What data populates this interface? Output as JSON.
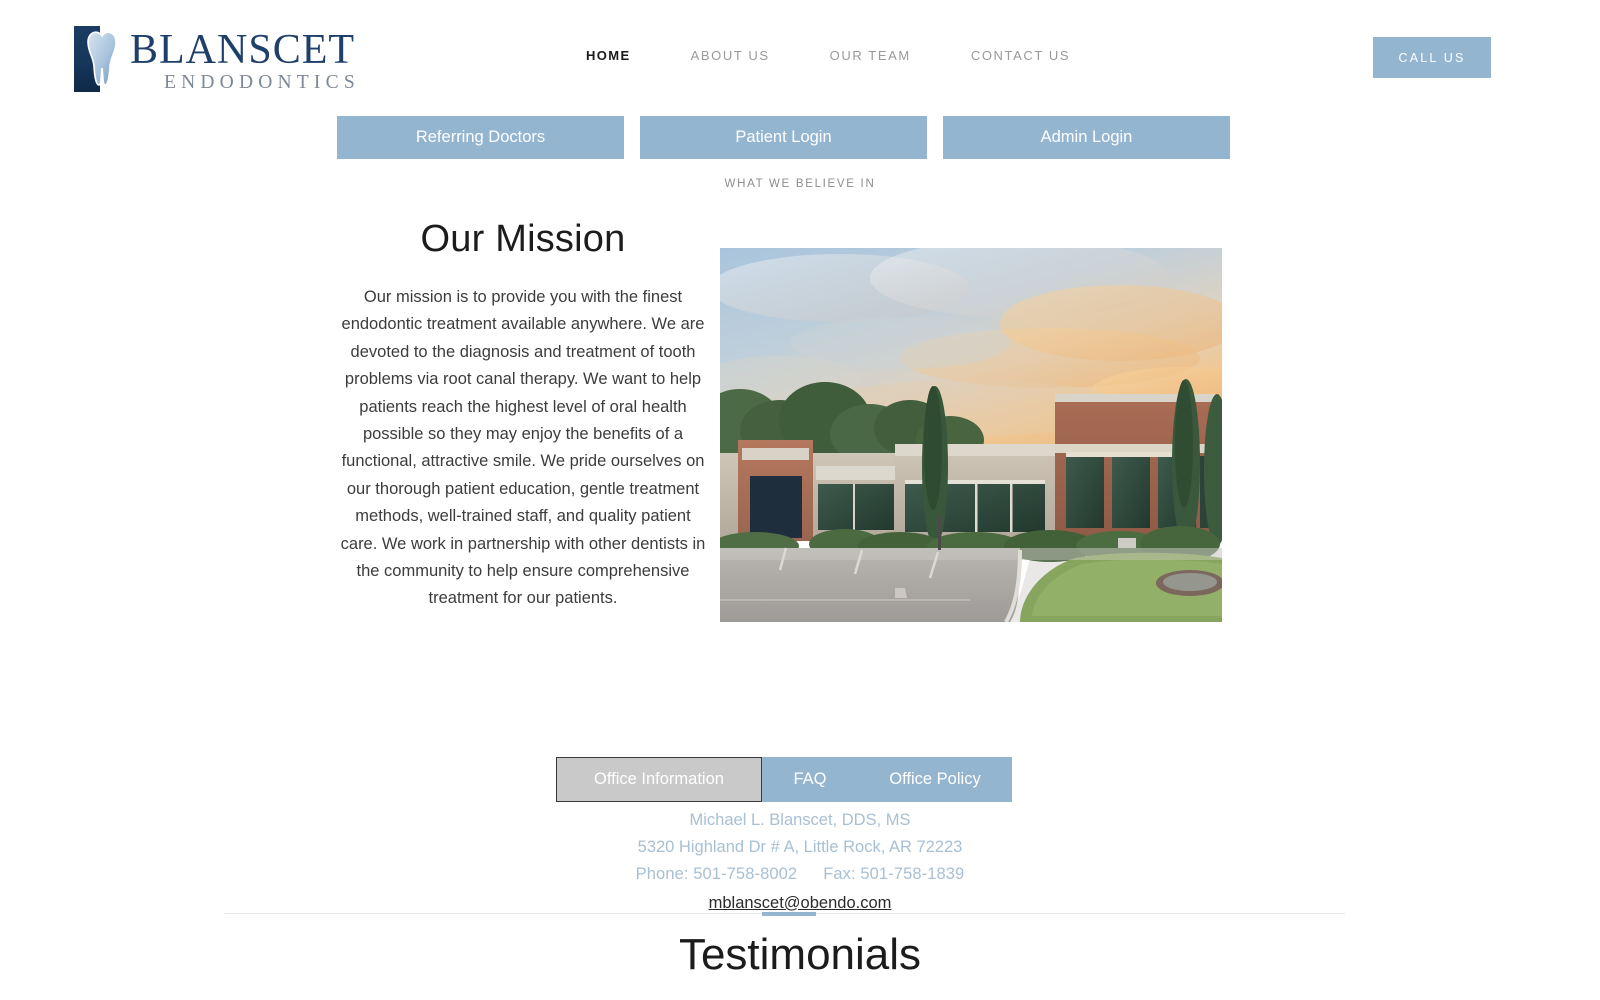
{
  "header": {
    "logo": {
      "mark_icon": "tooth-icon",
      "main_text": "BLANSCET",
      "sub_text": "ENDODONTICS"
    },
    "nav": [
      {
        "label": "HOME",
        "active": true
      },
      {
        "label": "ABOUT US",
        "active": false
      },
      {
        "label": "OUR TEAM",
        "active": false
      },
      {
        "label": "CONTACT US",
        "active": false
      }
    ],
    "call_button": "CALL US"
  },
  "quick_links": [
    {
      "label": "Referring Doctors"
    },
    {
      "label": "Patient Login"
    },
    {
      "label": "Admin Login"
    }
  ],
  "mission": {
    "eyebrow": "WHAT WE BELIEVE IN",
    "title": "Our Mission",
    "body": "Our mission is to provide you with the finest endodontic treatment available anywhere.  We are devoted to the diagnosis and treatment of tooth problems via root canal therapy.  We want to help patients reach the highest level of oral health possible so they may enjoy the benefits of a functional, attractive smile.  We pride ourselves on our thorough patient education, gentle treatment methods, well-trained staff, and quality patient care.  We work in partnership with other dentists in the community to help ensure comprehensive treatment for our patients.",
    "photo_alt": "office-building-at-sunset"
  },
  "office": {
    "tabs": [
      {
        "label": "Office Information",
        "active": true
      },
      {
        "label": "FAQ",
        "active": false
      },
      {
        "label": "Office Policy",
        "active": false
      }
    ],
    "doctor_name": "Michael L. Blanscet, DDS, MS",
    "address": "5320 Highland Dr # A, Little Rock, AR 72223",
    "phone": "Phone: 501-758-8002",
    "fax": "Fax: 501-758-1839",
    "email": "mblanscet@obendo.com"
  },
  "testimonials": {
    "title": "Testimonials"
  },
  "colors": {
    "accent_blue": "#93b5d0",
    "logo_navy": "#1d3f69",
    "logo_gray": "#7d8894",
    "active_tab_gray": "#c9c9c9",
    "info_text_blue": "#a8c0d4"
  }
}
